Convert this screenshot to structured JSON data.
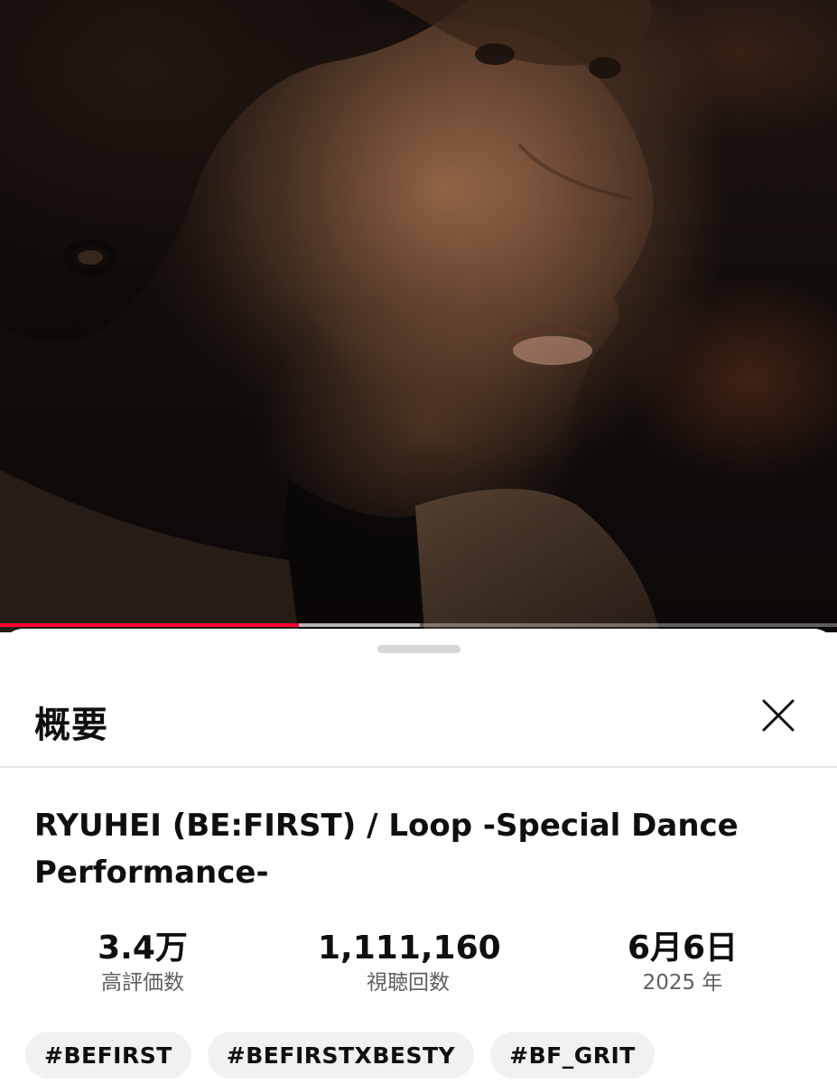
{
  "video": {
    "progress_played": 0.357,
    "progress_buffered": 0.502,
    "colors": {
      "played": "#ff0033"
    }
  },
  "description_sheet": {
    "title": "概要",
    "close_icon": "close-icon",
    "video_title": "RYUHEI (BE:FIRST) / Loop -Special Dance Performance-",
    "stats": {
      "likes": {
        "value": "3.4万",
        "label": "高評価数"
      },
      "views": {
        "value": "1,111,160",
        "label": "視聴回数"
      },
      "date": {
        "value": "6月6日",
        "label": "2025 年"
      }
    },
    "tags": [
      "#BEFIRST",
      "#BEFIRSTXBESTY",
      "#BF_GRIT"
    ]
  }
}
